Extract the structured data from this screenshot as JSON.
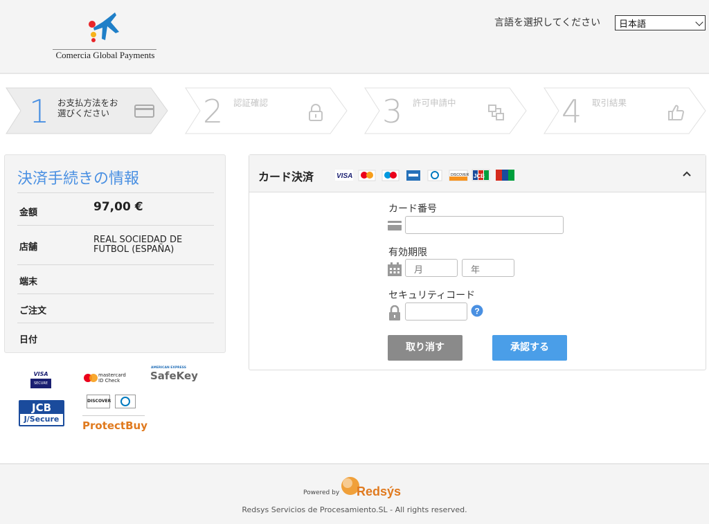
{
  "header": {
    "logo_text": "Comercia Global Payments",
    "language_label": "言語を選択してください",
    "language_selected": "日本語"
  },
  "steps": [
    {
      "number": "1",
      "label_line1": "お支払方法をお",
      "label_line2": "選びください",
      "icon": "credit-card-icon",
      "active": true
    },
    {
      "number": "2",
      "label_line1": "認証確認",
      "label_line2": "",
      "icon": "lock-icon",
      "active": false
    },
    {
      "number": "3",
      "label_line1": "許可申請中",
      "label_line2": "",
      "icon": "transfer-icon",
      "active": false
    },
    {
      "number": "4",
      "label_line1": "取引結果",
      "label_line2": "",
      "icon": "thumbs-up-icon",
      "active": false
    }
  ],
  "info": {
    "title": "決済手続きの情報",
    "rows": [
      {
        "key": "金額",
        "value": "97,00 €"
      },
      {
        "key": "店舗",
        "value_line1": "REAL SOCIEDAD DE",
        "value_line2": "FUTBOL (ESPAÑA)"
      },
      {
        "key": "端末",
        "value": ""
      },
      {
        "key": "ご注文",
        "value": ""
      },
      {
        "key": "日付",
        "value": ""
      }
    ]
  },
  "brands": {
    "visa": "VISA",
    "visa_sub": "SECURE",
    "mastercard": "mastercard",
    "mastercard_sub": "ID Check",
    "amex": "AMERICAN EXPRESS",
    "safekey": "SafeKey",
    "jcb": "JCB",
    "jsecure": "J/Secure",
    "discover": "DISCOVER",
    "protectbuy": "ProtectBuy"
  },
  "card": {
    "title": "カード決済",
    "logos": [
      "VISA",
      "mastercard",
      "maestro",
      "AMEX",
      "Diners",
      "DISCOVER",
      "JCB",
      "UnionPay"
    ],
    "card_number_label": "カード番号",
    "card_number_value": "",
    "expiry_label": "有効期限",
    "month_placeholder": "月",
    "year_placeholder": "年",
    "cvv_label": "セキュリティコード",
    "cvv_value": "",
    "cancel_label": "取り消す",
    "submit_label": "承認する",
    "accent": "#4a90e2"
  },
  "footer": {
    "powered_by": "Powered by",
    "brand": "Redsýs",
    "copyright": "Redsys Servicios de Procesamiento.SL - All rights reserved."
  }
}
